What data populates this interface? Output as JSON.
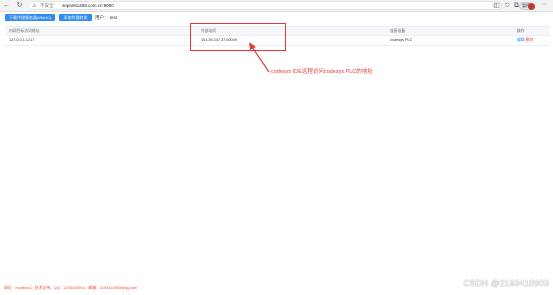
{
  "browser": {
    "security_label": "不安全",
    "url": "sepan61459.com.cn:9000",
    "profile_label": "暂停"
  },
  "toolbar": {
    "download_button": "下载代理服务器(Win10)",
    "add_agent_button": "添加代理转发",
    "user_label": "用户： test"
  },
  "table": {
    "headers": [
      "内网目标访问地址",
      "外部访问",
      "连接设备",
      "操作"
    ],
    "rows": [
      {
        "target": "127.0.0.1:1217",
        "external": "101.35.247.37:50049",
        "device": "codesys PLC",
        "edit": "编辑",
        "delete": "删除"
      }
    ]
  },
  "annotation": {
    "text": "codesys IDE远程访问codesys PLC的地址",
    "color": "#e53935"
  },
  "footer": {
    "text": "网址：modbus4，技术支持，QQ：2193410903，邮箱：2193410903@qq.com"
  },
  "watermark": "CSDN @2193410903",
  "colors": {
    "primary": "#2d8cf0",
    "danger": "#e74c3c"
  }
}
